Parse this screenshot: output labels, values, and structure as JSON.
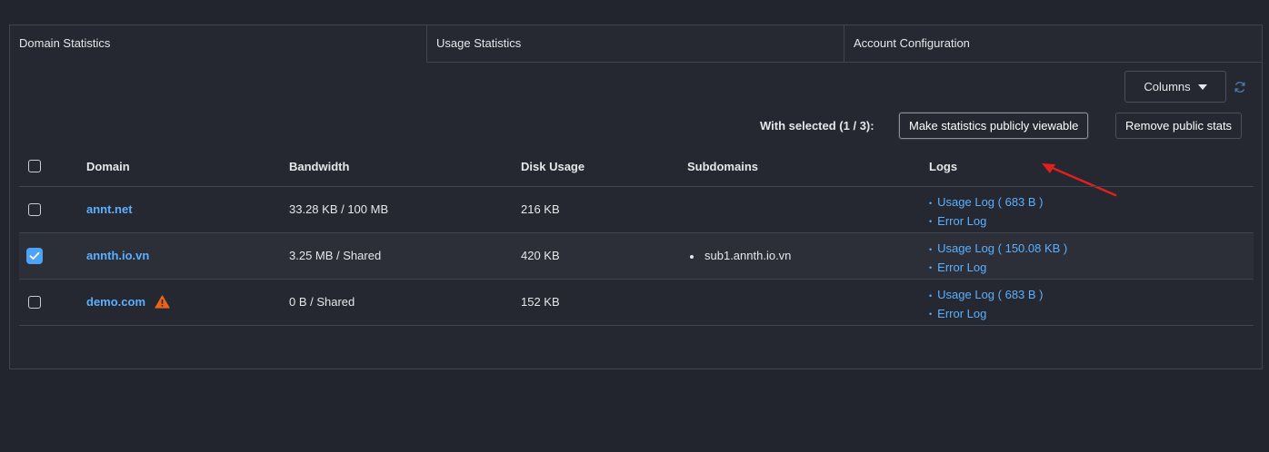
{
  "tabs": [
    {
      "label": "Domain Statistics",
      "active": true
    },
    {
      "label": "Usage Statistics",
      "active": false
    },
    {
      "label": "Account Configuration",
      "active": false
    }
  ],
  "toolbar": {
    "columns_label": "Columns",
    "refresh_icon": "refresh-icon",
    "with_selected_label": "With selected (1 / 3):",
    "make_public_label": "Make statistics publicly viewable",
    "remove_public_label": "Remove public stats"
  },
  "table": {
    "headers": {
      "domain": "Domain",
      "bandwidth": "Bandwidth",
      "disk_usage": "Disk Usage",
      "subdomains": "Subdomains",
      "logs": "Logs"
    },
    "rows": [
      {
        "checked": false,
        "domain": "annt.net",
        "warning": false,
        "bandwidth": "33.28 KB / 100 MB",
        "disk_usage": "216 KB",
        "subdomains": [],
        "usage_log": "Usage Log ( 683 B )",
        "error_log": "Error Log"
      },
      {
        "checked": true,
        "domain": "annth.io.vn",
        "warning": false,
        "bandwidth": "3.25 MB / Shared",
        "disk_usage": "420 KB",
        "subdomains": [
          "sub1.annth.io.vn"
        ],
        "usage_log": "Usage Log ( 150.08 KB )",
        "error_log": "Error Log"
      },
      {
        "checked": false,
        "domain": "demo.com",
        "warning": true,
        "bandwidth": "0 B / Shared",
        "disk_usage": "152 KB",
        "subdomains": [],
        "usage_log": "Usage Log ( 683 B )",
        "error_log": "Error Log"
      }
    ]
  },
  "colors": {
    "background": "#22252d",
    "link": "#5ab0ff",
    "checkbox_checked": "#4da3f7",
    "warning": "#e8641c",
    "annotation_arrow": "#e02020"
  }
}
